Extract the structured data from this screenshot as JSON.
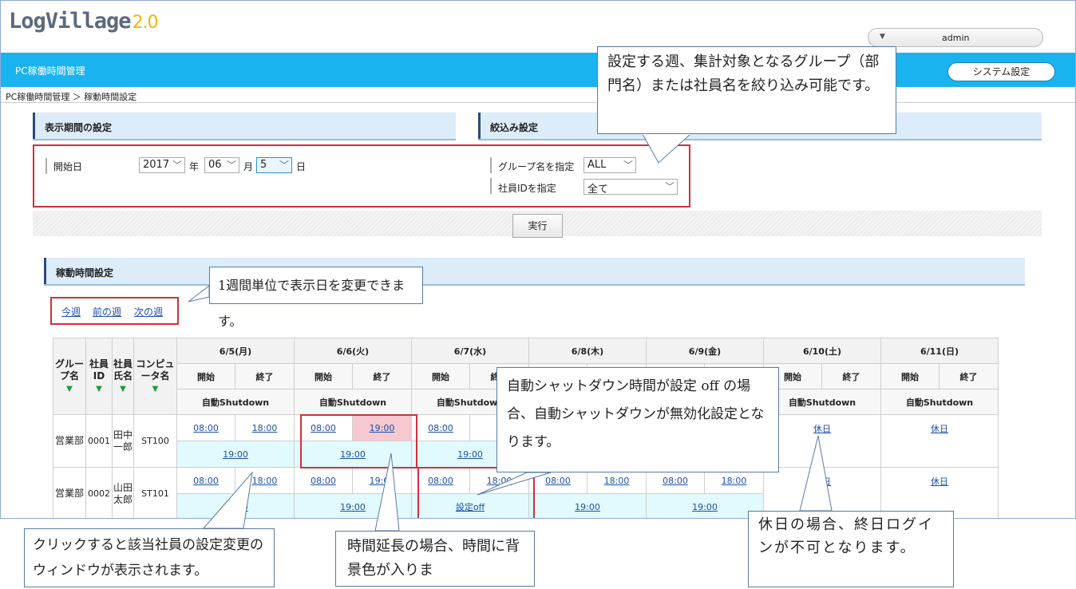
{
  "app": {
    "logo_text": "LogVillage",
    "logo_version": "2.0",
    "user_name": "admin",
    "section_title": "PC稼働時間管理",
    "system_settings_label": "システム設定",
    "breadcrumb": "PC稼働時間管理 ＞ 稼動時間設定"
  },
  "display_period": {
    "header": "表示期間の設定",
    "start_label": "開始日",
    "year": "2017",
    "year_unit": "年",
    "month": "06",
    "month_unit": "月",
    "day": "5",
    "day_unit": "日"
  },
  "filter": {
    "header": "絞込み設定",
    "group_label": "グループ名を指定",
    "group_value": "ALL",
    "employee_label": "社員IDを指定",
    "employee_value": "全て"
  },
  "execute_label": "実行",
  "schedule": {
    "header": "稼動時間設定",
    "nav": [
      "今週",
      "前の週",
      "次の週"
    ],
    "col_group": "グループ名",
    "col_emp_id": "社員ID",
    "col_emp_name": "社員氏名",
    "col_computer": "コンピュータ名",
    "sort_icon": "▼",
    "start_label": "開始",
    "end_label": "終了",
    "auto_label": "自動Shutdown",
    "days": [
      "6/5(月)",
      "6/6(火)",
      "6/7(水)",
      "6/8(木)",
      "6/9(金)",
      "6/10(土)",
      "6/11(日)"
    ],
    "rows": [
      {
        "group": "営業部",
        "id": "0001",
        "name": "田中一郎",
        "computer": "ST100",
        "cells": [
          {
            "start": "08:00",
            "end": "18:00",
            "shutdown": "19:00"
          },
          {
            "start": "08:00",
            "end": "19:00",
            "shutdown": "19:00"
          },
          {
            "start": "08:00",
            "end": "",
            "shutdown": "19:00"
          },
          {
            "start": "",
            "end": "",
            "shutdown": ""
          },
          {
            "start": "",
            "end": "",
            "shutdown": ""
          },
          {
            "holiday": "休日"
          },
          {
            "holiday": "休日"
          }
        ]
      },
      {
        "group": "営業部",
        "id": "0002",
        "name": "山田太郎",
        "computer": "ST101",
        "cells": [
          {
            "start": "08:00",
            "end": "18:00",
            "shutdown": "19:00"
          },
          {
            "start": "08:00",
            "end": "19:00",
            "shutdown": "19:00"
          },
          {
            "start": "08:00",
            "end": "18:00",
            "shutdown": "設定off"
          },
          {
            "start": "08:00",
            "end": "18:00",
            "shutdown": "19:00"
          },
          {
            "start": "08:00",
            "end": "18:00",
            "shutdown": "19:00"
          },
          {
            "holiday": "休日"
          },
          {
            "holiday": "休日"
          }
        ]
      }
    ]
  },
  "callouts": {
    "filter_note": "設定する週、集計対象となるグループ（部門名）または社員名を絞り込み可能です。",
    "week_note": "1週間単位で表示日を変更できます。",
    "shutdown_note": "自動シャットダウン時間が設定 off の場合、自動シャットダウンが無効化設定となります。",
    "click_note": "クリックすると該当社員の設定変更のウィンドウが表示されます。",
    "extend_note": "時間延長の場合、時間に背景色が入りま",
    "holiday_note": "休日の場合、終日ログインが不可となります。"
  },
  "colors": {
    "topbar": "#19b3f0",
    "accent_red": "#d0303c",
    "extended_bg": "#f6c9d0",
    "shutdown_bg": "#e0fafd"
  }
}
